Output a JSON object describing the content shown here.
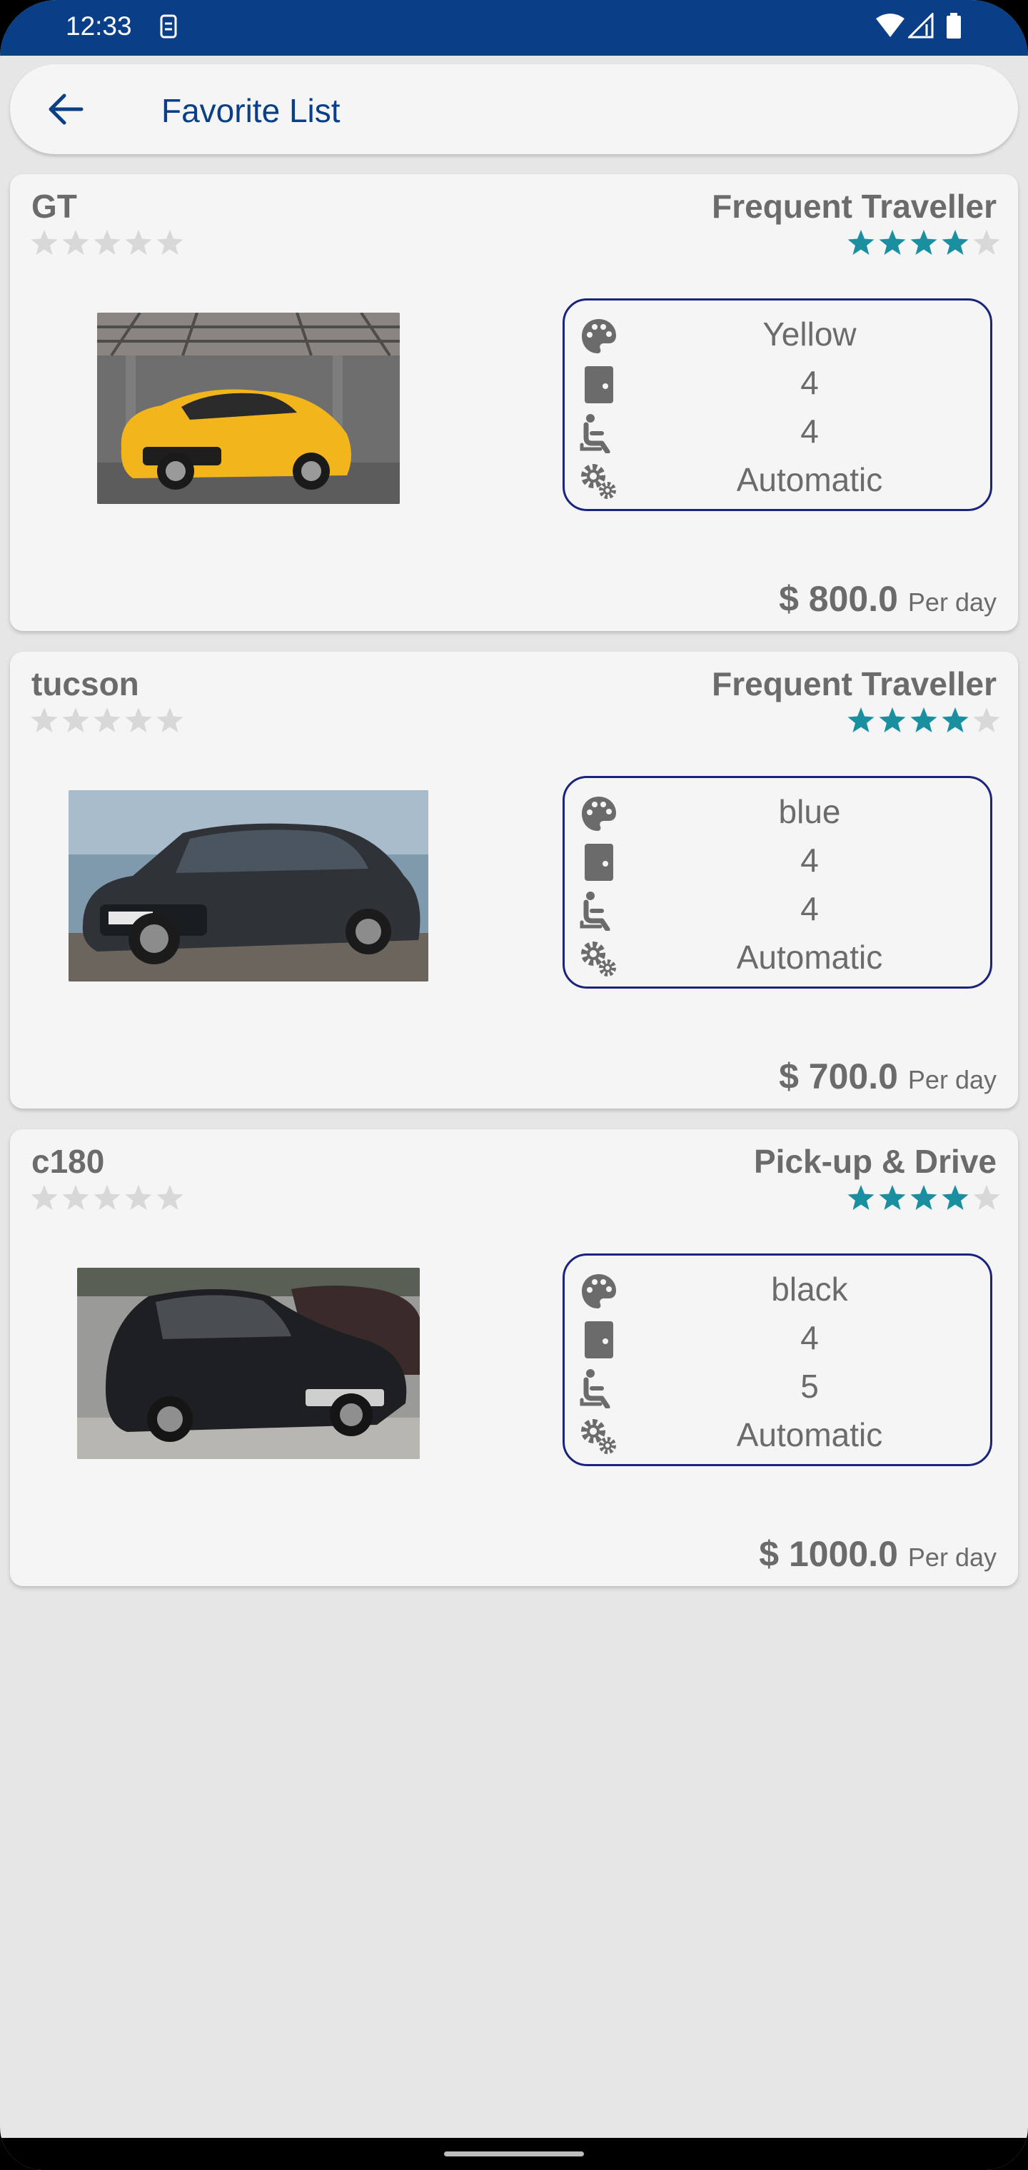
{
  "status_bar": {
    "time": "12:33"
  },
  "app_bar": {
    "title": "Favorite List"
  },
  "colors": {
    "primary": "#0a3f87",
    "star_active": "#1a8fa0",
    "star_inactive": "#d8d8d8",
    "border": "#1a237e",
    "text": "#6b6b6b"
  },
  "cards": [
    {
      "name": "GT",
      "user_rating": 0,
      "category": "Frequent Traveller",
      "category_rating": 4,
      "color": "Yellow",
      "doors": "4",
      "seats": "4",
      "transmission": "Automatic",
      "price": "$ 800.0",
      "per_day": "Per day"
    },
    {
      "name": "tucson",
      "user_rating": 0,
      "category": "Frequent Traveller",
      "category_rating": 4,
      "color": "blue",
      "doors": "4",
      "seats": "4",
      "transmission": "Automatic",
      "price": "$ 700.0",
      "per_day": "Per day"
    },
    {
      "name": "c180",
      "user_rating": 0,
      "category": "Pick-up & Drive",
      "category_rating": 4,
      "color": "black",
      "doors": "4",
      "seats": "5",
      "transmission": "Automatic",
      "price": "$ 1000.0",
      "per_day": "Per day"
    }
  ]
}
